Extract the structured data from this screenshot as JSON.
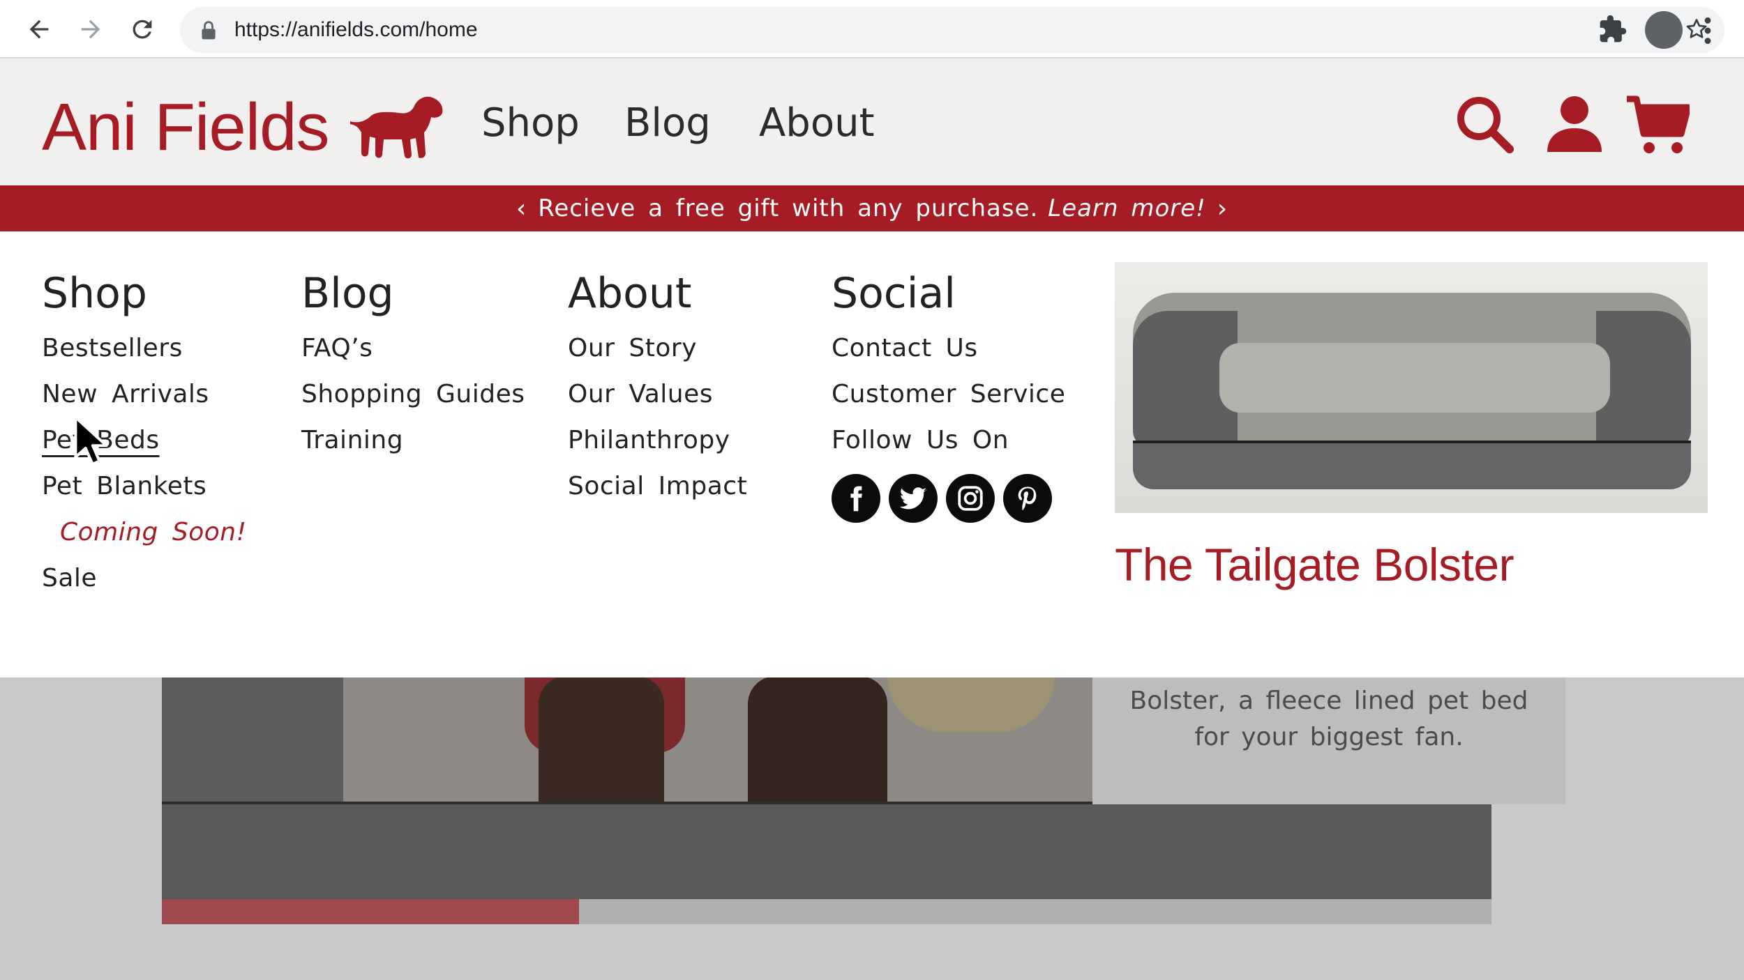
{
  "browser": {
    "url": "https://anifields.com/home"
  },
  "site": {
    "logo_text": "Ani Fields",
    "brand_color": "#a51c24",
    "nav": [
      "Shop",
      "Blog",
      "About"
    ]
  },
  "promo": {
    "text": "Recieve a free gift with any purchase.",
    "link": "Learn more!"
  },
  "menu": {
    "shop": {
      "heading": "Shop",
      "items": [
        "Bestsellers",
        "New Arrivals",
        "Pet Beds",
        "Pet Blankets",
        "Coming Soon!",
        "Sale"
      ]
    },
    "blog": {
      "heading": "Blog",
      "items": [
        "FAQ’s",
        "Shopping Guides",
        "Training"
      ]
    },
    "about": {
      "heading": "About",
      "items": [
        "Our Story",
        "Our Values",
        "Philanthropy",
        "Social Impact"
      ]
    },
    "social": {
      "heading": "Social",
      "items": [
        "Contact Us",
        "Customer Service",
        "Follow Us On"
      ],
      "icons": [
        "facebook-icon",
        "twitter-icon",
        "instagram-icon",
        "pinterest-icon"
      ]
    },
    "feature": {
      "title": "The Tailgate Bolster"
    }
  },
  "hero": {
    "caption_line1": "Bolster, a fleece lined pet bed",
    "caption_line2": "for your biggest fan.",
    "progress_fraction": 0.314
  }
}
